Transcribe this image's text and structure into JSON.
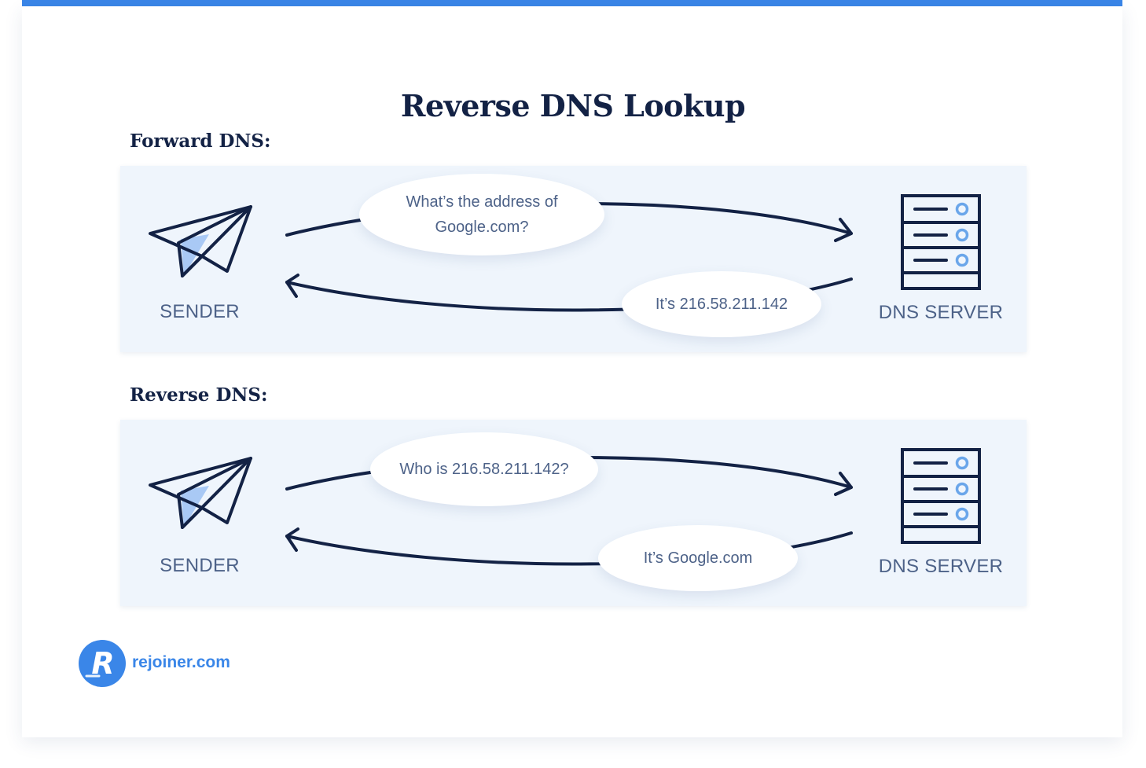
{
  "title": "Reverse DNS Lookup",
  "colors": {
    "accent": "#3a86e8",
    "navy": "#132245",
    "panel": "#eff5fc",
    "label": "#4d6288",
    "plane_fill": "#a9c9f5"
  },
  "sections": [
    {
      "label": "Forward DNS:",
      "sender_label": "SENDER",
      "server_label": "DNS SERVER",
      "request_bubble": [
        "What’s the address of",
        "Google.com?"
      ],
      "response_bubble": [
        "It’s 216.58.211.142"
      ]
    },
    {
      "label": "Reverse DNS:",
      "sender_label": "SENDER",
      "server_label": "DNS SERVER",
      "request_bubble": [
        "Who is 216.58.211.142?"
      ],
      "response_bubble": [
        "It’s Google.com"
      ]
    }
  ],
  "icons": {
    "sender": "paper-plane-icon",
    "server": "server-rack-icon",
    "brand": "rejoiner-logo-icon"
  },
  "brand": {
    "logo_letter": "R",
    "name": "rejoiner.com"
  }
}
